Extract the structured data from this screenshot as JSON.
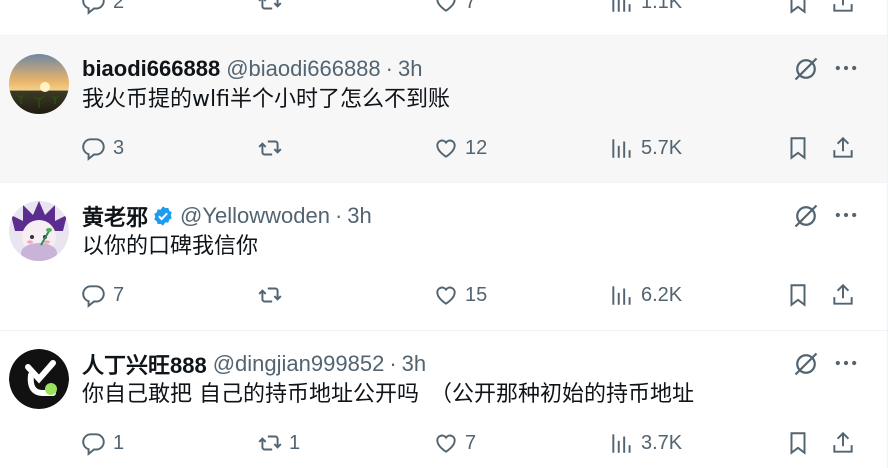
{
  "top_row": {
    "replies": "2",
    "likes": "7",
    "views": "1.1K"
  },
  "posts": [
    {
      "name": "biaodi666888",
      "handle": "@biaodi666888",
      "dot": "·",
      "time": "3h",
      "text": "我火币提的wlfi半个小时了怎么不到账",
      "verified": false,
      "replies": "3",
      "reposts": "",
      "likes": "12",
      "views": "5.7K"
    },
    {
      "name": "黄老邪",
      "handle": "@Yellowwoden",
      "dot": "·",
      "time": "3h",
      "text": "以你的口碑我信你",
      "verified": true,
      "replies": "7",
      "reposts": "",
      "likes": "15",
      "views": "6.2K"
    },
    {
      "name": "人丁兴旺888",
      "handle": "@dingjian999852",
      "dot": "·",
      "time": "3h",
      "text": "你自己敢把 自己的持币地址公开吗　（公开那种初始的持币地址",
      "verified": false,
      "replies": "1",
      "reposts": "1",
      "likes": "7",
      "views": "3.7K"
    }
  ],
  "colors": {
    "muted": "#536471",
    "text": "#0f1419",
    "verified": "#1d9bf0",
    "highlight_bg": "#f7f7f7"
  },
  "icons": [
    "reply-icon",
    "repost-icon",
    "like-icon",
    "views-icon",
    "bookmark-icon",
    "share-icon",
    "grok-icon",
    "more-icon",
    "verified-badge-icon"
  ]
}
